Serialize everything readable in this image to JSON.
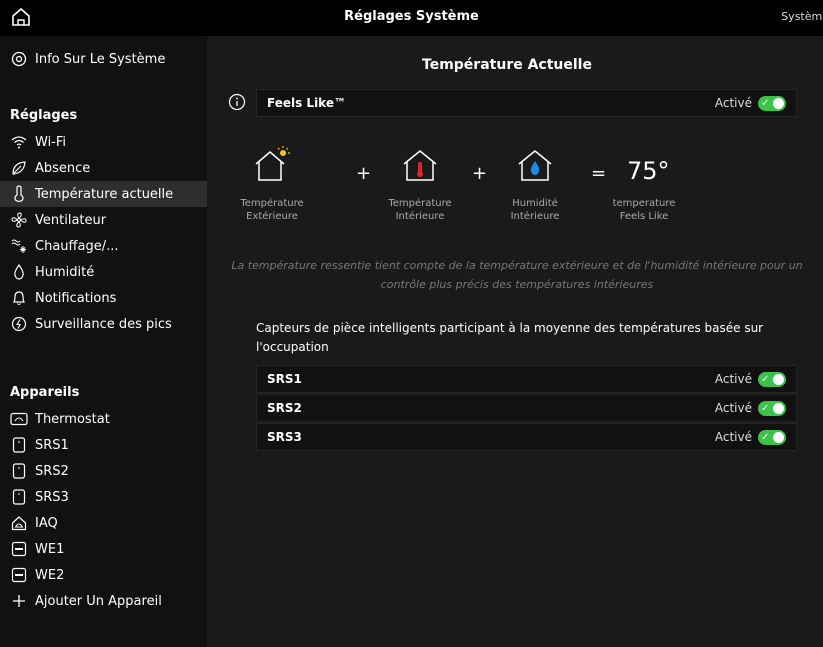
{
  "topbar": {
    "title": "Réglages Système",
    "right_text": "Système"
  },
  "sidebar": {
    "info": {
      "label": "Info Sur Le Système",
      "icon": "gear-icon"
    },
    "settings_header": "Réglages",
    "settings_items": [
      {
        "label": "Wi-Fi",
        "icon": "wifi-icon"
      },
      {
        "label": "Absence",
        "icon": "leaf-icon"
      },
      {
        "label": "Température actuelle",
        "icon": "thermometer-icon",
        "active": true
      },
      {
        "label": "Ventilateur",
        "icon": "fan-icon"
      },
      {
        "label": "Chauffage/...",
        "icon": "heat-cool-icon"
      },
      {
        "label": "Humidité",
        "icon": "droplet-icon"
      },
      {
        "label": "Notifications",
        "icon": "bell-icon"
      },
      {
        "label": "Surveillance des pics",
        "icon": "peak-icon"
      }
    ],
    "devices_header": "Appareils",
    "device_items": [
      {
        "label": "Thermostat",
        "icon": "thermostat-icon"
      },
      {
        "label": "SRS1",
        "icon": "sensor-icon"
      },
      {
        "label": "SRS2",
        "icon": "sensor-icon"
      },
      {
        "label": "SRS3",
        "icon": "sensor-icon"
      },
      {
        "label": "IAQ",
        "icon": "iaq-icon"
      },
      {
        "label": "WE1",
        "icon": "equipment-icon"
      },
      {
        "label": "WE2",
        "icon": "equipment-icon"
      }
    ],
    "add_device": {
      "label": "Ajouter Un Appareil",
      "icon": "plus-icon"
    }
  },
  "main": {
    "title": "Température Actuelle",
    "feels_like": {
      "label": "Feels Like™",
      "status": "Activé",
      "enabled": true
    },
    "formula": {
      "plus1": "+",
      "plus2": "+",
      "equals": "=",
      "value": "75°",
      "captions": [
        "Température\nExtérieure",
        "Température\nIntérieure",
        "Humidité\nIntérieure",
        "temperature\nFeels Like"
      ]
    },
    "description": "La température ressentie tient compte de la température extérieure et de l'humidité intérieure pour un contrôle plus précis des températures intérieures",
    "sensors_heading": "Capteurs de pièce intelligents participant à la moyenne des températures basée sur l'occupation",
    "sensors": [
      {
        "name": "SRS1",
        "status": "Activé",
        "enabled": true
      },
      {
        "name": "SRS2",
        "status": "Activé",
        "enabled": true
      },
      {
        "name": "SRS3",
        "status": "Activé",
        "enabled": true
      }
    ]
  },
  "colors": {
    "toggle_on": "#3cc24b",
    "accent_red": "#e0242c",
    "accent_blue": "#1e88e5",
    "sun": "#f5c518"
  }
}
